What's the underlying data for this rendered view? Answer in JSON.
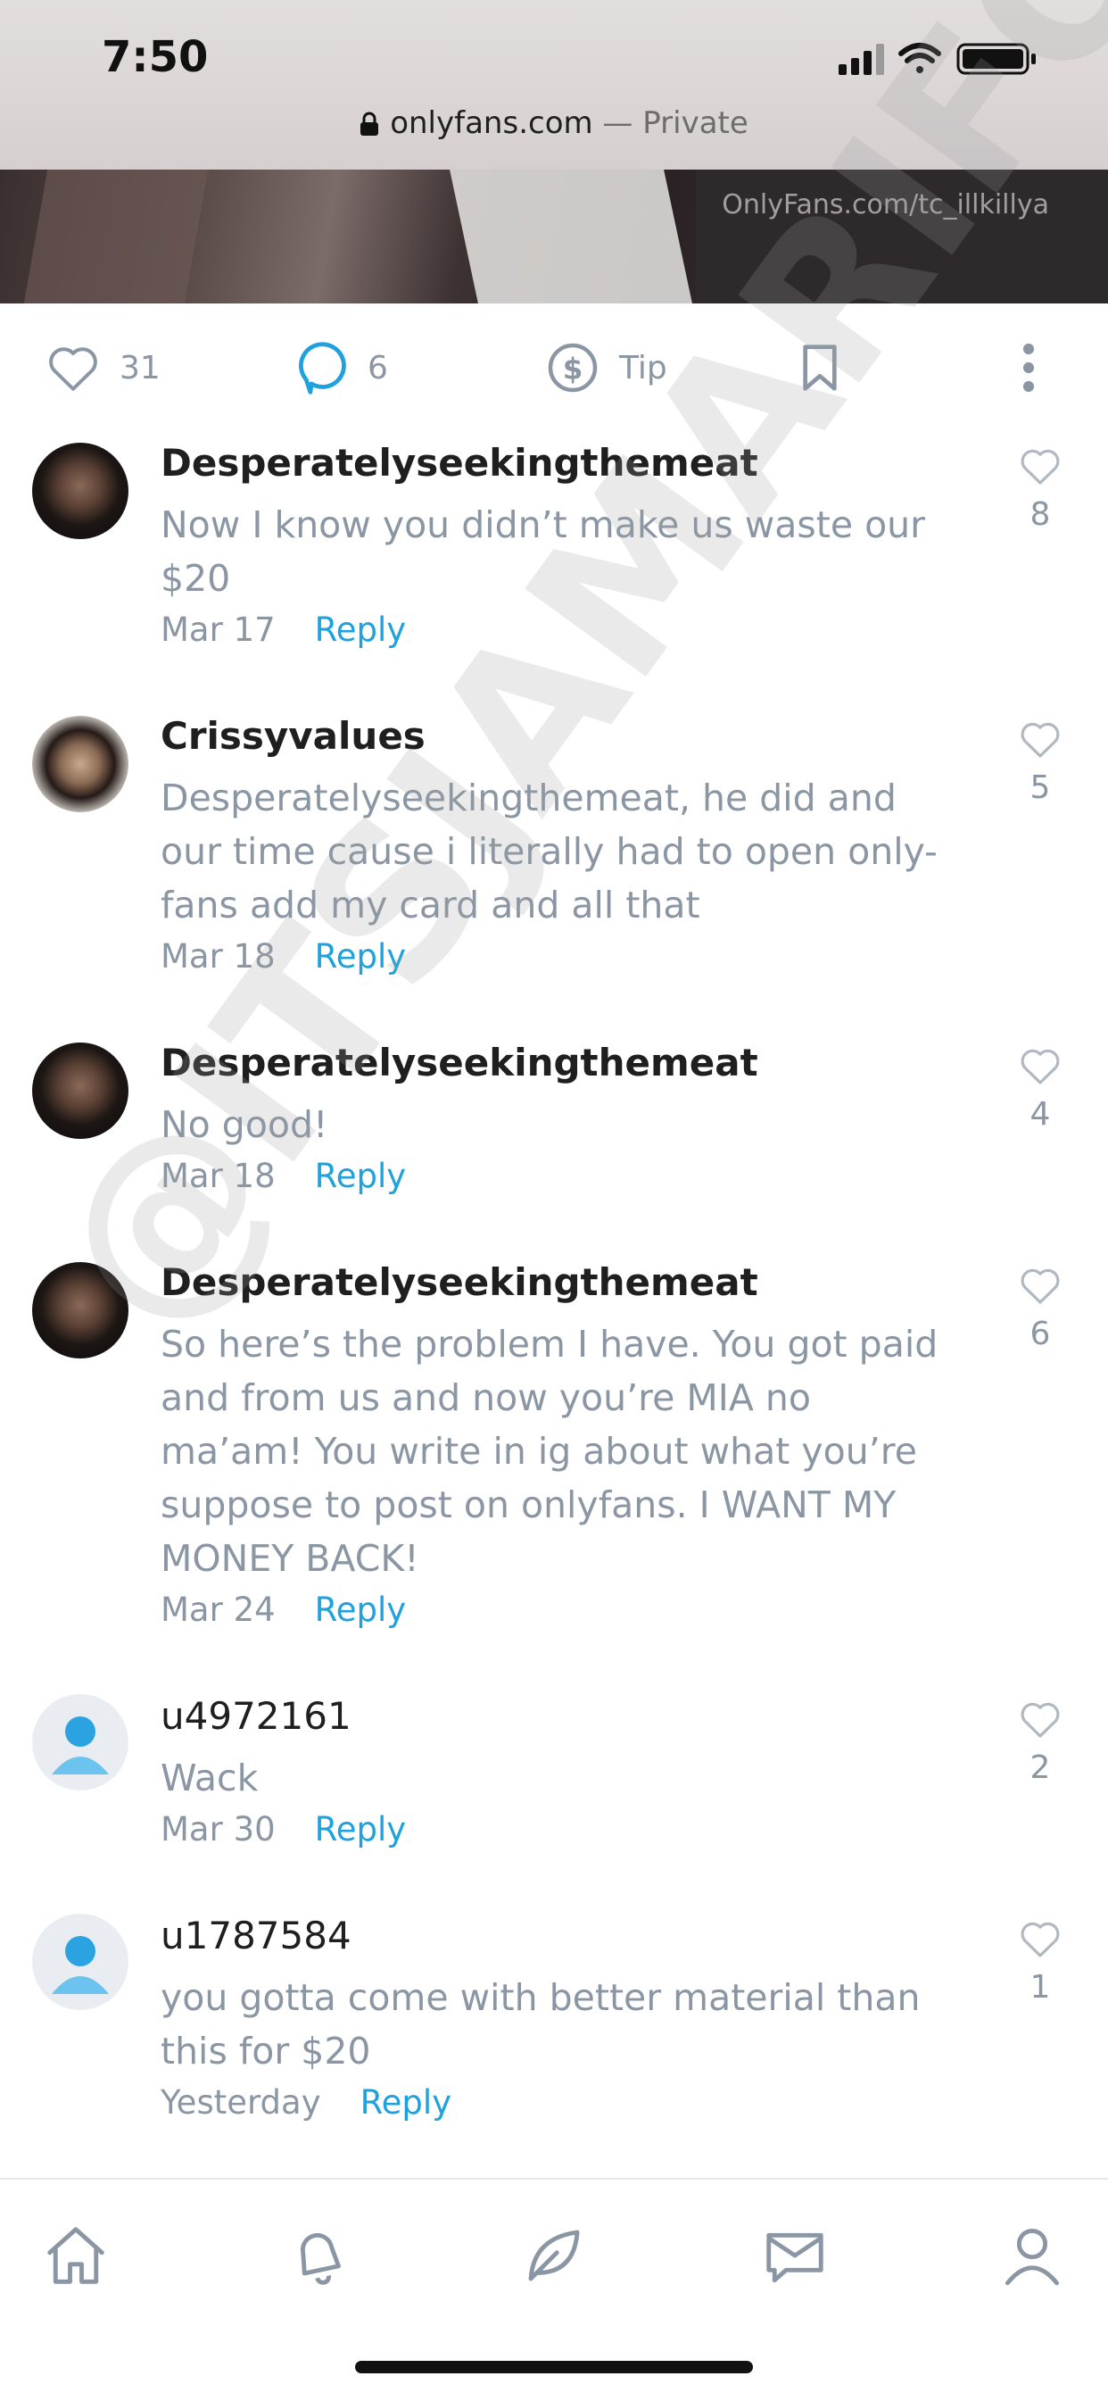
{
  "status_bar": {
    "time": "7:50"
  },
  "url_bar": {
    "domain": "onlyfans.com",
    "separator": " — ",
    "mode": "Private"
  },
  "media": {
    "watermark": "OnlyFans.com/tc_illkillya"
  },
  "post_actions": {
    "likes": "31",
    "comments": "6",
    "tip_label": "Tip"
  },
  "comments": [
    {
      "author": "Desperatelyseekingthemeat",
      "text": "Now I know you didn’t make us waste our $20",
      "date": "Mar 17",
      "reply": "Reply",
      "likes": "8"
    },
    {
      "author": "Crissyvalues",
      "text": "Desperatelyseekingthemeat, he did and our time cause i literally had to open only-fans add my card and all that",
      "date": "Mar 18",
      "reply": "Reply",
      "likes": "5"
    },
    {
      "author": "Desperatelyseekingthemeat",
      "text": "No good!",
      "date": "Mar 18",
      "reply": "Reply",
      "likes": "4"
    },
    {
      "author": "Desperatelyseekingthemeat",
      "text": "So here’s the problem I have. You got paid and from us and now you’re MIA no ma’am! You write in ig about what you’re suppose to post on onlyfans. I WANT MY MONEY BACK!",
      "date": "Mar 24",
      "reply": "Reply",
      "likes": "6"
    },
    {
      "author": "u4972161",
      "text": "Wack",
      "date": "Mar 30",
      "reply": "Reply",
      "likes": "2"
    },
    {
      "author": "u1787584",
      "text": "you gotta come with better material than this for $20",
      "date": "Yesterday",
      "reply": "Reply",
      "likes": "1"
    }
  ],
  "overlay_watermark": "@ITSJAMARIFOX",
  "colors": {
    "accent": "#1ea1dc",
    "muted": "#8a96a3"
  }
}
